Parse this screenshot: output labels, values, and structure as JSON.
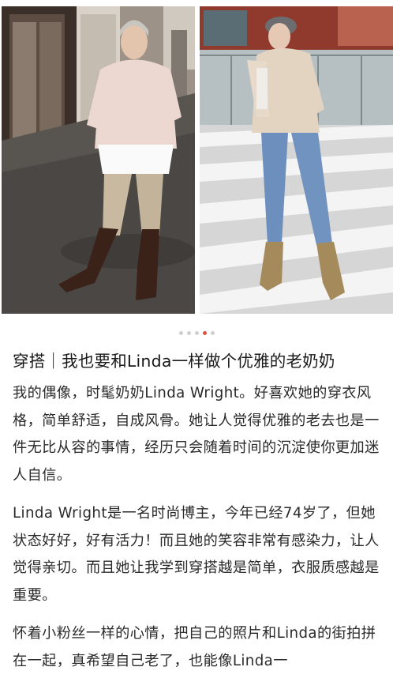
{
  "carousel": {
    "dot_count": 5,
    "active_index": 3,
    "accent_color": "#e0533f",
    "photos": [
      {
        "icon": "street-portrait-silver-hair-photo"
      },
      {
        "icon": "crosswalk-portrait-grey-beret-photo"
      }
    ]
  },
  "article": {
    "title": "穿搭｜我也要和Linda一样做个优雅的老奶奶",
    "paragraphs": [
      "我的偶像，时髦奶奶Linda Wright。好喜欢她的穿衣风格，简单舒适，自成风骨。她让人觉得优雅的老去也是一件无比从容的事情，经历只会随着时间的沉淀使你更加迷人自信。",
      "Linda Wright是一名时尚博主，今年已经74岁了，但她状态好好，好有活力！而且她的笑容非常有感染力，让人觉得亲切。而且她让我学到穿搭越是简单，衣服质感越是重要。",
      "怀着小粉丝一样的心情，把自己的照片和Linda的街拍拼在一起，真希望自己老了，也能像Linda一"
    ]
  }
}
